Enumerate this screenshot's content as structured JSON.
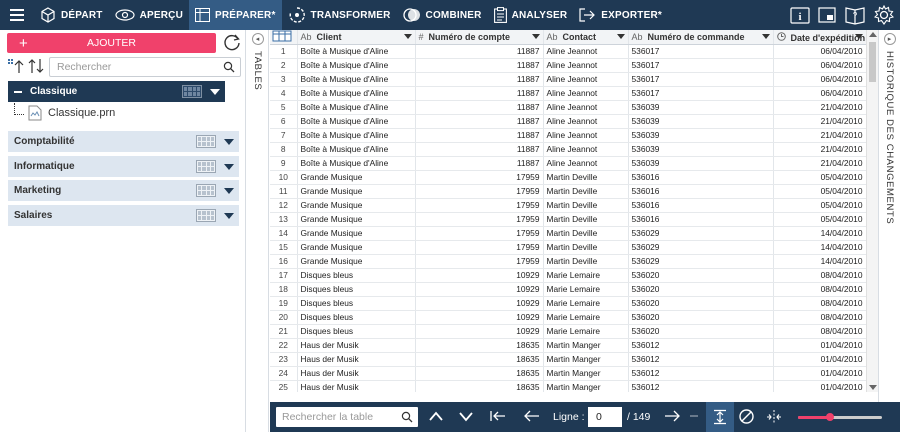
{
  "toolbar": {
    "items": [
      {
        "label": "DÉPART",
        "icon": "cube-icon"
      },
      {
        "label": "APERÇU",
        "icon": "eye-icon"
      },
      {
        "label": "PRÉPARER*",
        "icon": "table-icon"
      },
      {
        "label": "TRANSFORMER",
        "icon": "transform-icon"
      },
      {
        "label": "COMBINER",
        "icon": "combine-icon"
      },
      {
        "label": "ANALYSER",
        "icon": "clipboard-icon"
      },
      {
        "label": "EXPORTER*",
        "icon": "export-icon"
      }
    ],
    "active_index": 2
  },
  "left_panel": {
    "add_label": "AJOUTER",
    "search_placeholder": "Rechercher",
    "groups": [
      {
        "label": "Classique",
        "selected": true
      },
      {
        "label": "Comptabilité"
      },
      {
        "label": "Informatique"
      },
      {
        "label": "Marketing"
      },
      {
        "label": "Salaires"
      }
    ],
    "file_name": "Classique.prn"
  },
  "side_tabs": {
    "left": "TABLES",
    "right": "HISTORIQUE DES CHANGEMENTS"
  },
  "table": {
    "columns": [
      {
        "type": "Ab",
        "label": "Client"
      },
      {
        "type": "#",
        "label": "Numéro de compte"
      },
      {
        "type": "Ab",
        "label": "Contact"
      },
      {
        "type": "Ab",
        "label": "Numéro de commande"
      },
      {
        "type": "date",
        "label": "Date d'expédition"
      }
    ],
    "rows": [
      [
        "1",
        "Boîte à Musique d'Aline",
        "11887",
        "Aline Jeannot",
        "536017",
        "06/04/2010"
      ],
      [
        "2",
        "Boîte à Musique d'Aline",
        "11887",
        "Aline Jeannot",
        "536017",
        "06/04/2010"
      ],
      [
        "3",
        "Boîte à Musique d'Aline",
        "11887",
        "Aline Jeannot",
        "536017",
        "06/04/2010"
      ],
      [
        "4",
        "Boîte à Musique d'Aline",
        "11887",
        "Aline Jeannot",
        "536017",
        "06/04/2010"
      ],
      [
        "5",
        "Boîte à Musique d'Aline",
        "11887",
        "Aline Jeannot",
        "536039",
        "21/04/2010"
      ],
      [
        "6",
        "Boîte à Musique d'Aline",
        "11887",
        "Aline Jeannot",
        "536039",
        "21/04/2010"
      ],
      [
        "7",
        "Boîte à Musique d'Aline",
        "11887",
        "Aline Jeannot",
        "536039",
        "21/04/2010"
      ],
      [
        "8",
        "Boîte à Musique d'Aline",
        "11887",
        "Aline Jeannot",
        "536039",
        "21/04/2010"
      ],
      [
        "9",
        "Boîte à Musique d'Aline",
        "11887",
        "Aline Jeannot",
        "536039",
        "21/04/2010"
      ],
      [
        "10",
        "Grande Musique",
        "17959",
        "Martin Deville",
        "536016",
        "05/04/2010"
      ],
      [
        "11",
        "Grande Musique",
        "17959",
        "Martin Deville",
        "536016",
        "05/04/2010"
      ],
      [
        "12",
        "Grande Musique",
        "17959",
        "Martin Deville",
        "536016",
        "05/04/2010"
      ],
      [
        "13",
        "Grande Musique",
        "17959",
        "Martin Deville",
        "536016",
        "05/04/2010"
      ],
      [
        "14",
        "Grande Musique",
        "17959",
        "Martin Deville",
        "536029",
        "14/04/2010"
      ],
      [
        "15",
        "Grande Musique",
        "17959",
        "Martin Deville",
        "536029",
        "14/04/2010"
      ],
      [
        "16",
        "Grande Musique",
        "17959",
        "Martin Deville",
        "536029",
        "14/04/2010"
      ],
      [
        "17",
        "Disques bleus",
        "10929",
        "Marie Lemaire",
        "536020",
        "08/04/2010"
      ],
      [
        "18",
        "Disques bleus",
        "10929",
        "Marie Lemaire",
        "536020",
        "08/04/2010"
      ],
      [
        "19",
        "Disques bleus",
        "10929",
        "Marie Lemaire",
        "536020",
        "08/04/2010"
      ],
      [
        "20",
        "Disques bleus",
        "10929",
        "Marie Lemaire",
        "536020",
        "08/04/2010"
      ],
      [
        "21",
        "Disques bleus",
        "10929",
        "Marie Lemaire",
        "536020",
        "08/04/2010"
      ],
      [
        "22",
        "Haus der Musik",
        "18635",
        "Martin Manger",
        "536012",
        "01/04/2010"
      ],
      [
        "23",
        "Haus der Musik",
        "18635",
        "Martin Manger",
        "536012",
        "01/04/2010"
      ],
      [
        "24",
        "Haus der Musik",
        "18635",
        "Martin Manger",
        "536012",
        "01/04/2010"
      ],
      [
        "25",
        "Haus der Musik",
        "18635",
        "Martin Manger",
        "536012",
        "01/04/2010"
      ]
    ]
  },
  "footer": {
    "search_placeholder": "Rechercher la table",
    "ligne_label": "Ligne :",
    "ligne_value": "0",
    "total": "/ 149",
    "zoom_level": 0.38
  },
  "colors": {
    "nav_bg": "#1f3954",
    "accent": "#f0416b",
    "group_bg": "#dde6f0"
  }
}
